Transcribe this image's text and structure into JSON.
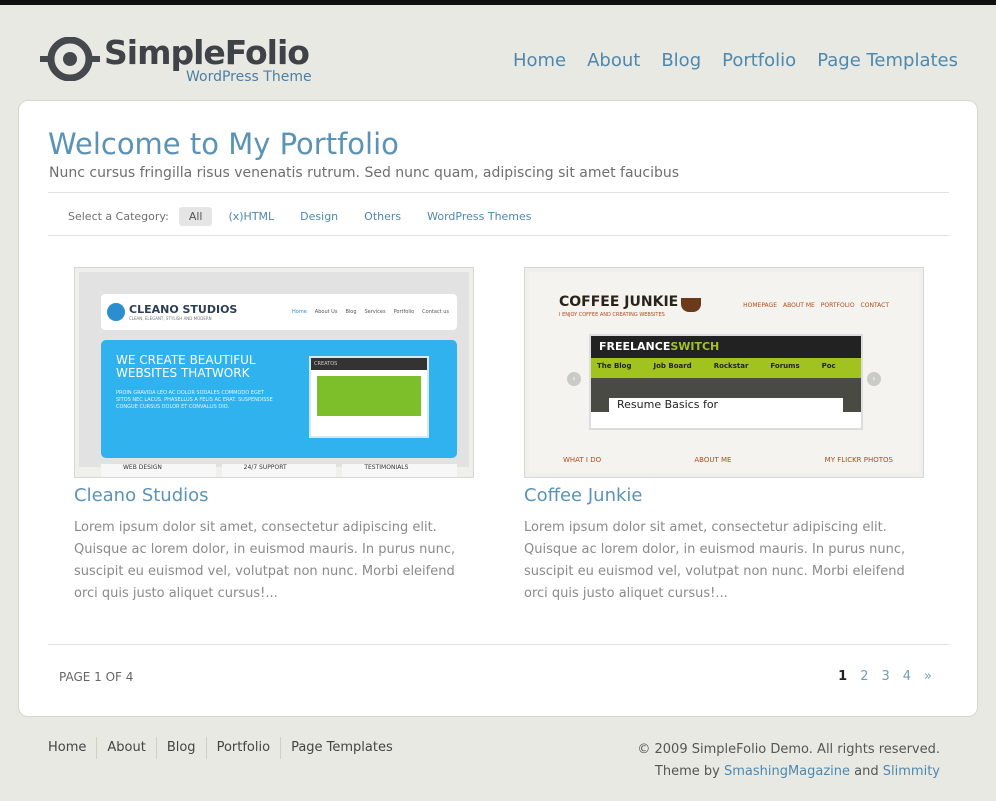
{
  "header": {
    "logo_name": "SimpleFolio",
    "logo_sub": "WordPress Theme",
    "nav": [
      "Home",
      "About",
      "Blog",
      "Portfolio",
      "Page Templates"
    ]
  },
  "main": {
    "title": "Welcome to My Portfolio",
    "description": "Nunc cursus fringilla risus venenatis rutrum. Sed nunc quam, adipiscing sit amet faucibus",
    "category_label": "Select a Category:",
    "categories": [
      "All",
      "(x)HTML",
      "Design",
      "Others",
      "WordPress Themes"
    ],
    "items": [
      {
        "title": "Cleano Studios",
        "text": "Lorem ipsum dolor sit amet, consectetur adipiscing elit. Quisque ac lorem dolor, in euismod mauris. In purus nunc, suscipit eu euismod vel, volutpat non nunc. Morbi eleifend orci quis justo aliquet cursus!...",
        "thumb": {
          "brand": "CLEANO STUDIOS",
          "tagline": "CLEAN, ELEGANT, STYLISH AND MODERN",
          "menu": [
            "Home",
            "About Us",
            "Blog",
            "Services",
            "Portfolio",
            "Contact us"
          ],
          "hero": "WE CREATE BEAUTIFUL WEBSITES THATWORK",
          "hero_text": "PROIN GRAVIDA LEO AC DOLOR SODALES COMMODO EGET SITOS NEC LACUS. PHASELLUS A FELIS AC ERAT. SUSPENDISSE CONGUE CURSUS DOLOR ET CONVALLIS DIO.",
          "window_title": "CREATOS",
          "row": [
            "WEB DESIGN",
            "24/7 SUPPORT",
            "TESTIMONIALS"
          ]
        }
      },
      {
        "title": "Coffee Junkie",
        "text": "Lorem ipsum dolor sit amet, consectetur adipiscing elit. Quisque ac lorem dolor, in euismod mauris. In purus nunc, suscipit eu euismod vel, volutpat non nunc. Morbi eleifend orci quis justo aliquet cursus!...",
        "thumb": {
          "brand": "COFFEE JUNKIE",
          "tagline": "I ENJOY COFFEE AND CREATING WEBSITES",
          "menu": [
            "HOMEPAGE",
            "ABOUT ME",
            "PORTFOLIO",
            "CONTACT"
          ],
          "site_a": "FREELANCE",
          "site_b": "SWITCH",
          "site_menu": [
            "The Blog",
            "Job Board",
            "Rockstar",
            "Forums",
            "Poc"
          ],
          "article": "Resume Basics for",
          "links": [
            "WHAT I DO",
            "ABOUT ME",
            "MY FLICKR PHOTOS"
          ]
        }
      }
    ],
    "page_of": "PAGE 1 OF 4",
    "pager": [
      "1",
      "2",
      "3",
      "4",
      "»"
    ]
  },
  "footer": {
    "nav": [
      "Home",
      "About",
      "Blog",
      "Portfolio",
      "Page Templates"
    ],
    "copyright": "© 2009 SimpleFolio Demo. All rights reserved.",
    "theme_by": "Theme by",
    "link1": "SmashingMagazine",
    "and": "and",
    "link2": "Slimmity"
  }
}
